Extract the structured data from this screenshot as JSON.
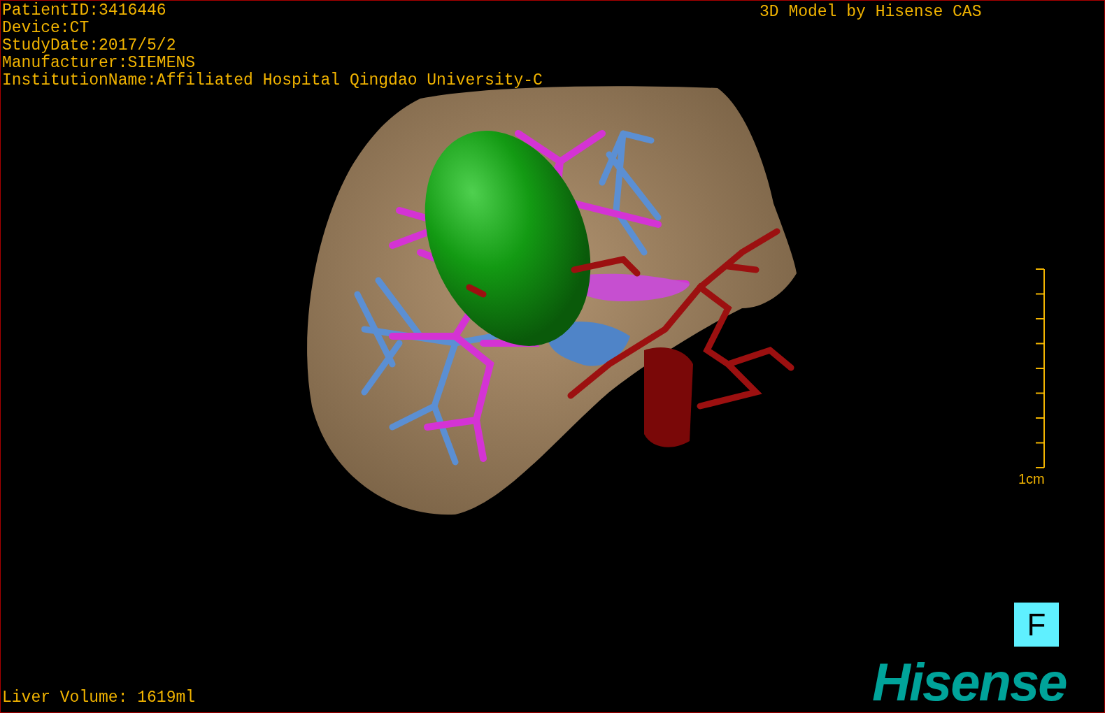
{
  "study_info": [
    "PatientID:3416446",
    "Device:CT",
    "StudyDate:2017/5/2",
    "Manufacturer:SIEMENS",
    "InstitutionName:Affiliated Hospital Qingdao University-C"
  ],
  "model_label": "3D Model by Hisense CAS",
  "scale_bar": {
    "label": "1cm"
  },
  "orientation": {
    "label": "F"
  },
  "logo": "Hisense",
  "liver_volume": "Liver Volume: 1619ml"
}
